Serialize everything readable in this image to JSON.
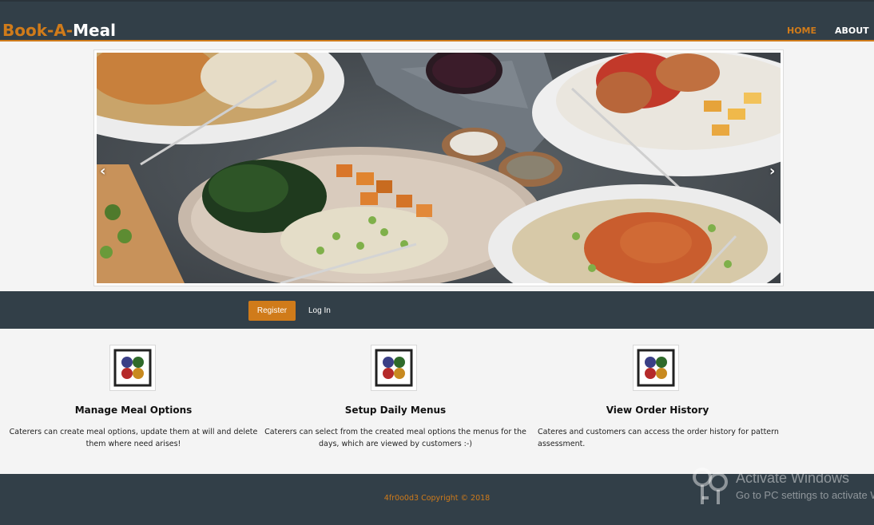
{
  "navbar": {
    "brand_part1": "Book-A-",
    "brand_part2": "Meal",
    "links": [
      {
        "label": "HOME",
        "active": true
      },
      {
        "label": "ABOUT",
        "active": false
      }
    ]
  },
  "carousel": {
    "prev_arrow": "‹",
    "next_arrow": "›"
  },
  "auth": {
    "register_label": "Register",
    "login_label": "Log In"
  },
  "features": [
    {
      "title": "Manage Meal Options",
      "description": "Caterers can create meal options, update them at will and delete them where need arises!"
    },
    {
      "title": "Setup Daily Menus",
      "description": "Caterers can select from the created meal options the menus for the days, which are viewed by customers :-)"
    },
    {
      "title": "View Order History",
      "description": "Cateres and customers can access the order history for pattern assessment."
    }
  ],
  "footer": {
    "copyright": "4fr0o0d3 Copyright © 2018"
  },
  "watermark": {
    "title": "Activate Windows",
    "subtitle": "Go to PC settings to activate Windows."
  },
  "colors": {
    "accent": "#d07b1a",
    "dark": "#323f48",
    "background": "#f4f4f4"
  }
}
